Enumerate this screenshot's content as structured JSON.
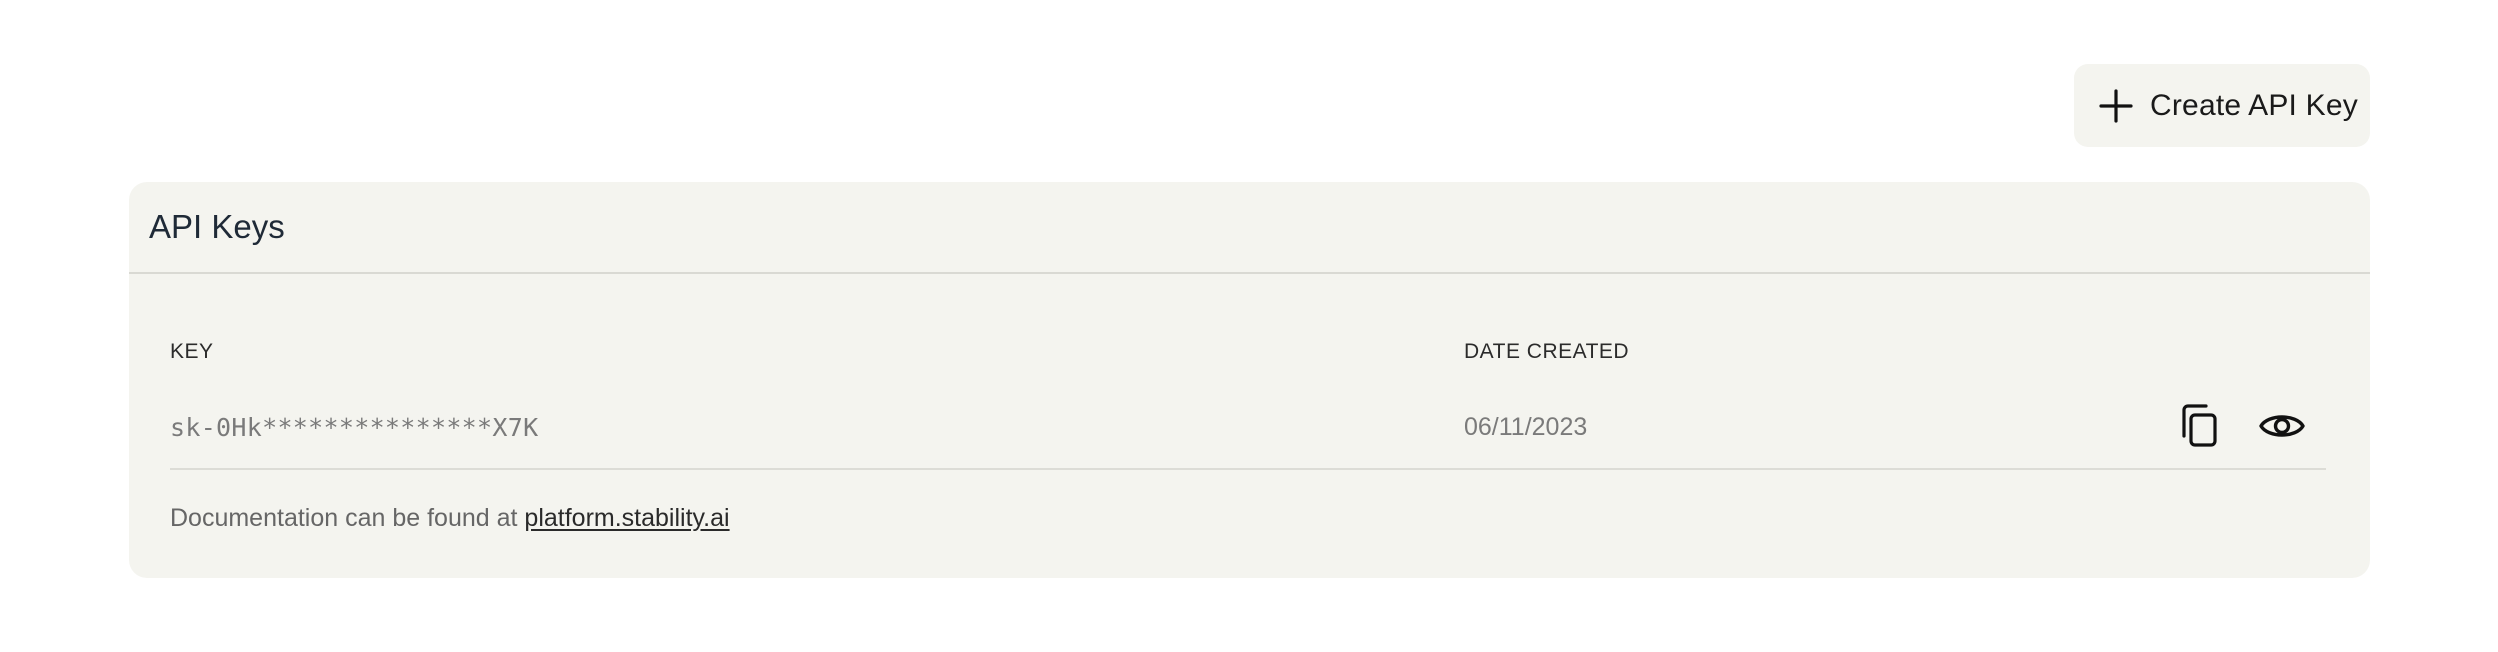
{
  "toolbar": {
    "create_label": "Create API Key",
    "create_icon": "plus-icon"
  },
  "card": {
    "title": "API Keys",
    "columns": {
      "key": "KEY",
      "date_created": "DATE CREATED"
    },
    "rows": [
      {
        "key": "sk-0Hk***************X7K",
        "date_created": "06/11/2023",
        "actions": [
          "copy-icon",
          "eye-icon"
        ]
      }
    ],
    "doc_text": "Documentation can be found at ",
    "doc_link": "platform.stability.ai"
  },
  "colors": {
    "card_background": "#f4f4ef",
    "text_primary": "#1a1a1a",
    "text_muted": "#7a7a7a"
  }
}
